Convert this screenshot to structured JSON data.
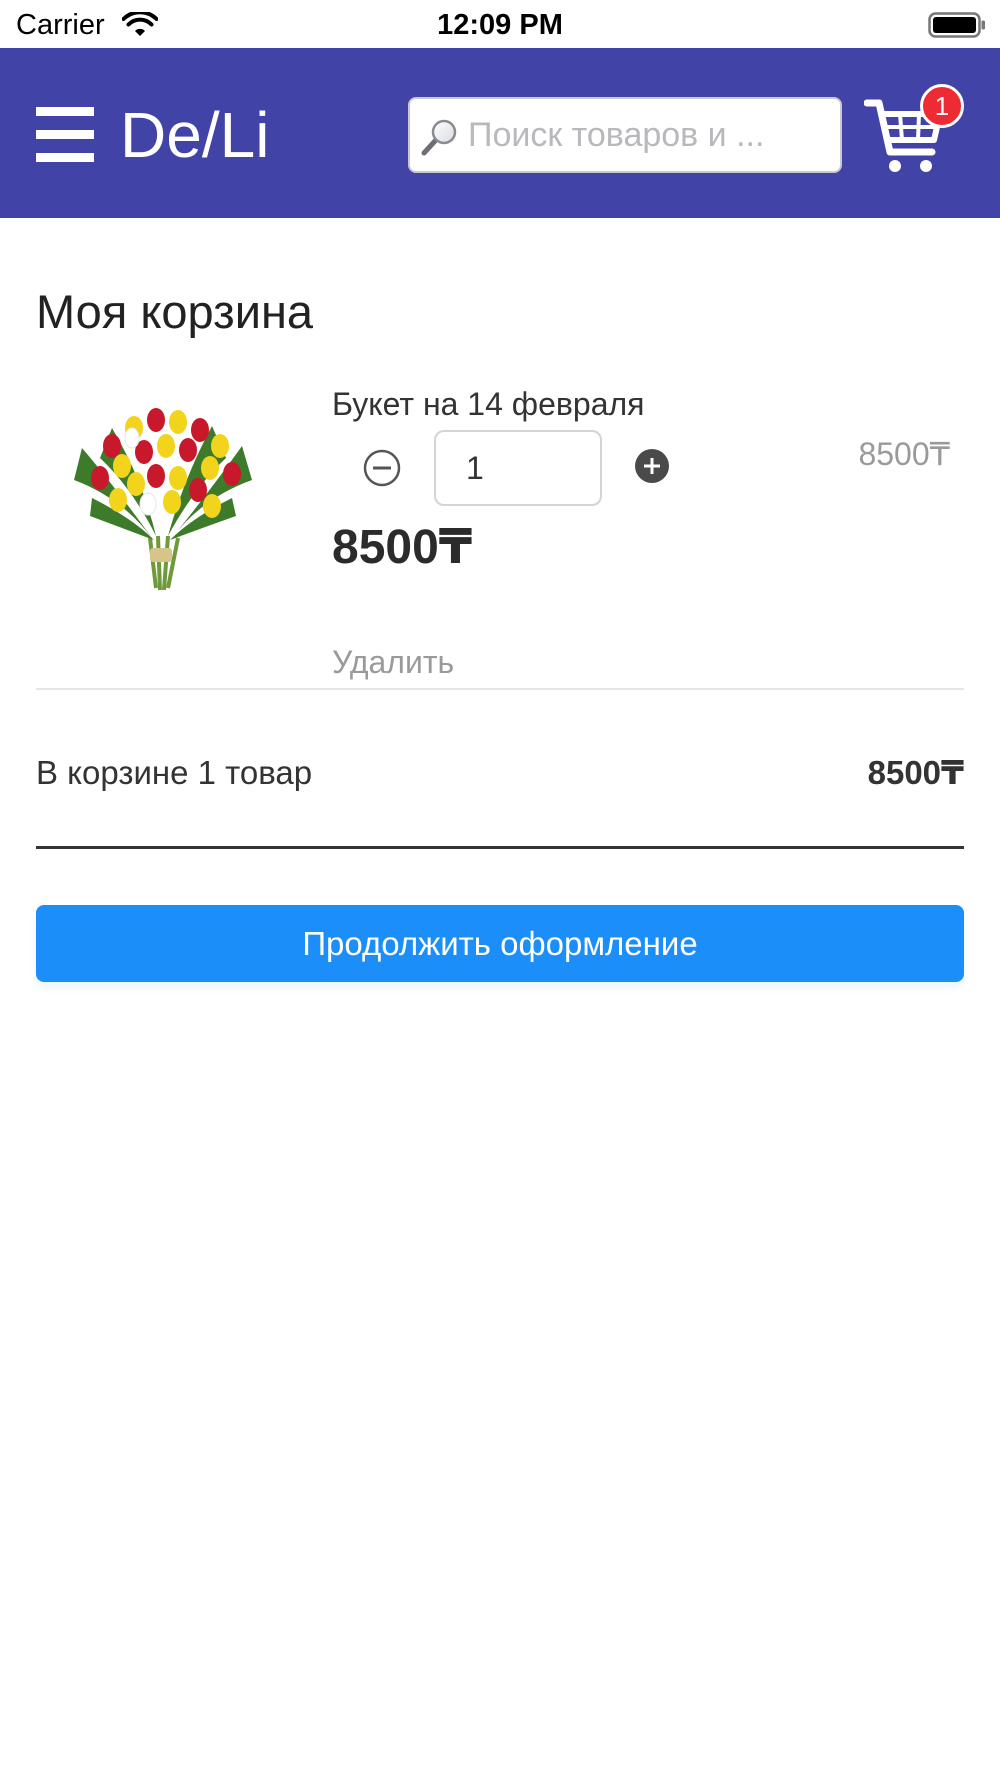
{
  "status_bar": {
    "carrier": "Carrier",
    "time": "12:09 PM"
  },
  "header": {
    "brand": "De/Li",
    "search_placeholder": "Поиск товаров и ...",
    "cart_count": "1",
    "accent_color": "#4143a6"
  },
  "cart": {
    "title": "Моя корзина",
    "items": [
      {
        "name": "Букет на 14 февраля",
        "quantity": "1",
        "unit_price": "8500₸",
        "total": "8500₸",
        "remove_label": "Удалить",
        "image": "tulip-bouquet-image"
      }
    ],
    "summary_label": "В корзине 1 товар",
    "summary_total": "8500₸",
    "checkout_label": "Продолжить оформление",
    "checkout_color": "#1c8ef9"
  }
}
